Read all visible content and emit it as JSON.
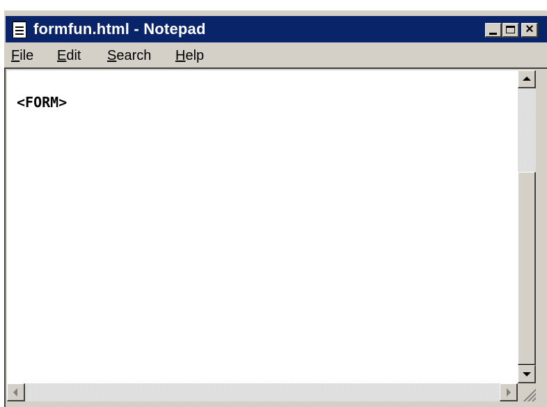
{
  "window": {
    "title": "formfun.html - Notepad",
    "controls": {
      "minimize_icon": "minimize-icon",
      "maximize_icon": "maximize-icon",
      "close_icon": "close-icon",
      "close_glyph": "×"
    }
  },
  "menu": {
    "items": [
      {
        "accel": "F",
        "rest": "ile"
      },
      {
        "accel": "E",
        "rest": "dit"
      },
      {
        "accel": "S",
        "rest": "earch"
      },
      {
        "accel": "H",
        "rest": "elp"
      }
    ]
  },
  "editor": {
    "content": "<FORM>"
  },
  "colors": {
    "titlebar": "#0a246a",
    "chrome": "#d4d0c8",
    "editor_bg": "#ffffff"
  }
}
